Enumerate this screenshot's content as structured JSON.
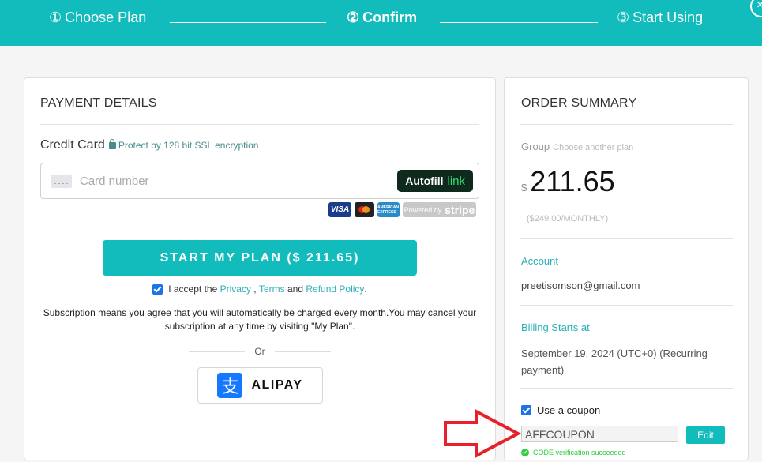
{
  "header": {
    "steps": [
      {
        "num": "①",
        "label": "Choose Plan",
        "active": false
      },
      {
        "num": "②",
        "label": "Confirm",
        "active": true
      },
      {
        "num": "③",
        "label": "Start Using",
        "active": false
      }
    ],
    "close_glyph": "×"
  },
  "payment": {
    "title": "PAYMENT DETAILS",
    "credit_card_label": "Credit Card",
    "ssl_text": "Protect by 128 bit SSL encryption",
    "card_placeholder": "Card number",
    "autofill_label": "Autofill",
    "autofill_link": "link",
    "brands": {
      "visa": "VISA",
      "amex": "AMERICAN EXPRESS",
      "stripe_prefix": "Powered by",
      "stripe_name": "stripe"
    },
    "start_button": "START MY PLAN ($ 211.65)",
    "accept": {
      "checked": true,
      "prefix": "I accept the",
      "privacy": "Privacy",
      "comma": ",",
      "terms": "Terms",
      "and": "and",
      "refund": "Refund Policy",
      "period": "."
    },
    "subscription_text": "Subscription means you agree that you will automatically be charged every month.You may cancel your subscription at any time by visiting \"My Plan\".",
    "or_label": "Or",
    "alipay_glyph": "支",
    "alipay_label": "ALIPAY"
  },
  "summary": {
    "title": "ORDER SUMMARY",
    "group_label": "Group",
    "choose_another": "Choose another plan",
    "currency": "$",
    "price": "211.65",
    "monthly": "($249.00/MONTHLY)",
    "account_label": "Account",
    "account_value": "preetisomson@gmail.com",
    "billing_label": "Billing Starts at",
    "billing_value": "September 19, 2024 (UTC+0) (Recurring payment)",
    "coupon": {
      "checked": true,
      "label": "Use a coupon",
      "value": "AFFCOUPON",
      "edit_label": "Edit",
      "status": "CODE verification succeeded"
    }
  },
  "colors": {
    "brand": "#12bcbc",
    "link": "#2bb0b8",
    "success": "#2ecc40",
    "annotation": "#e8202a"
  }
}
